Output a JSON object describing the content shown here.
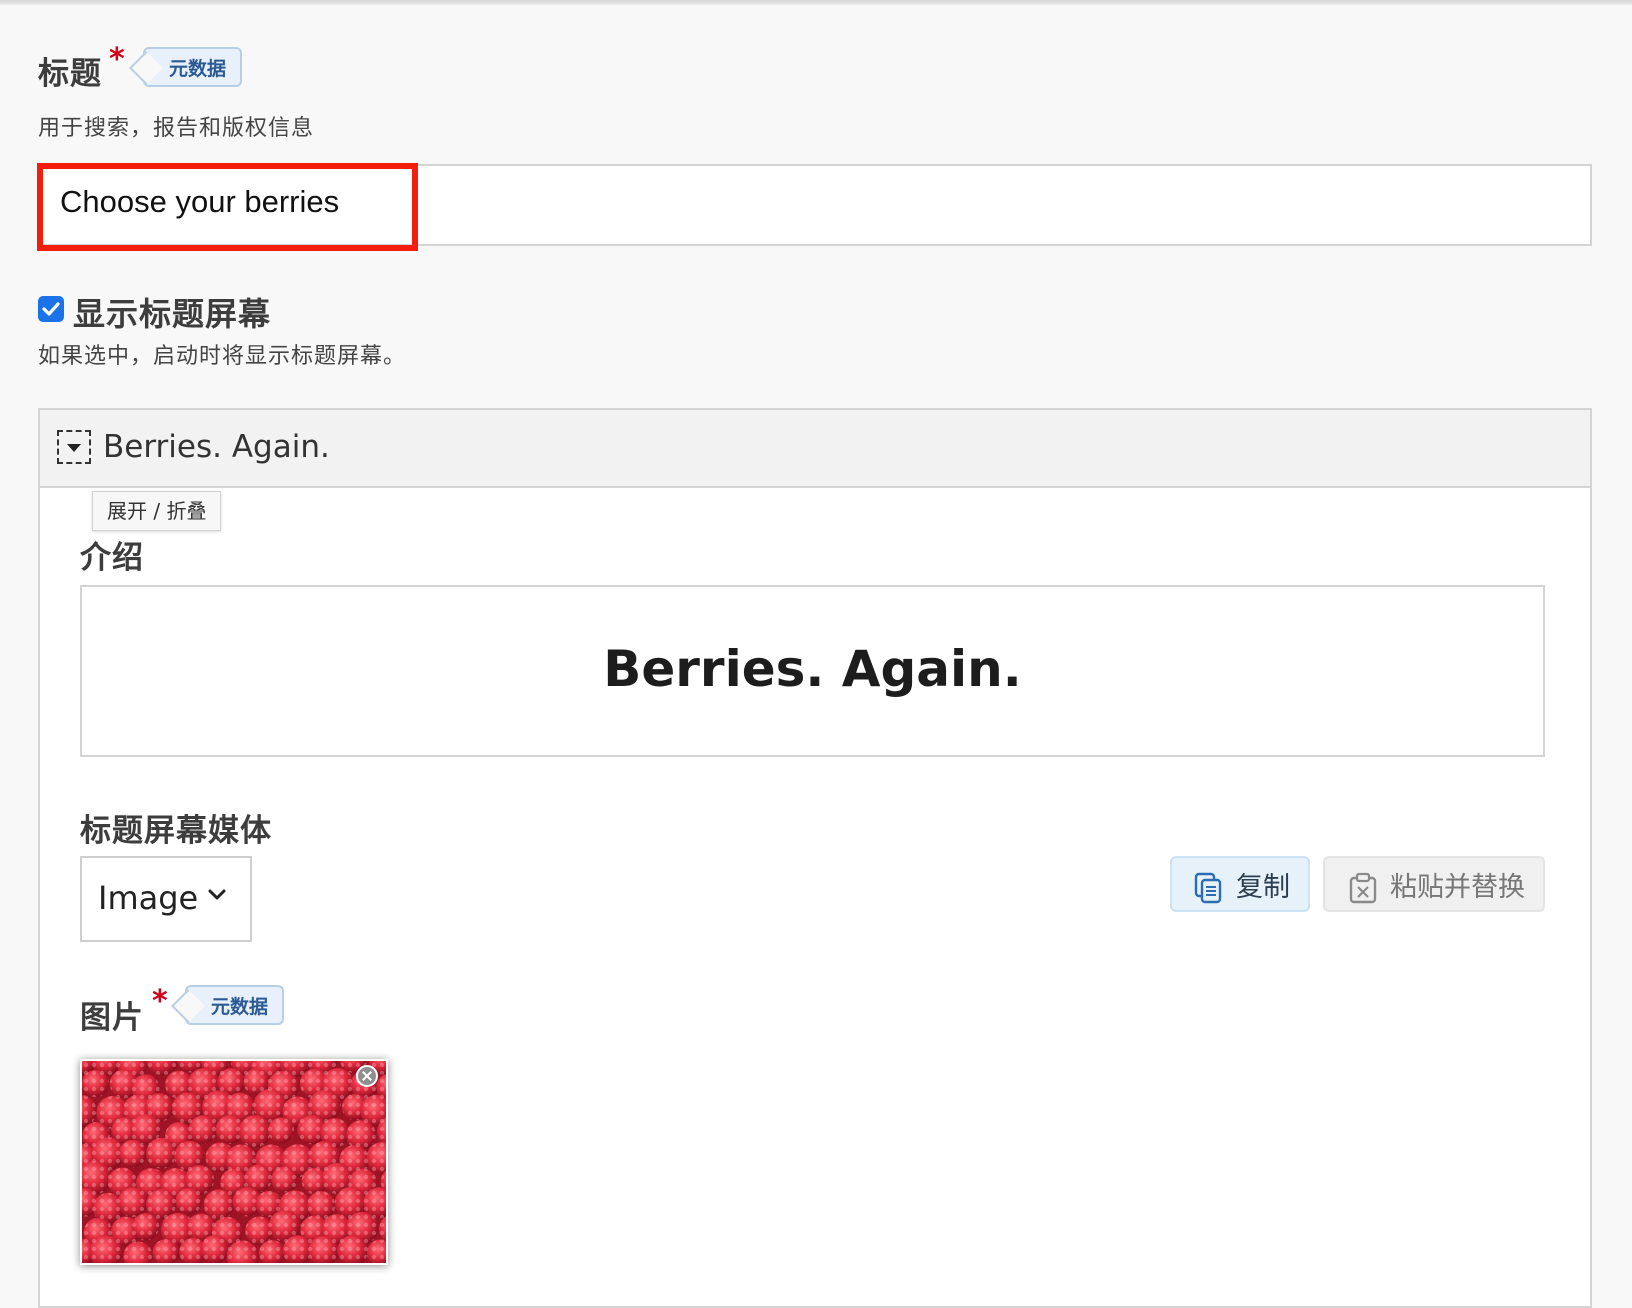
{
  "title_field": {
    "label": "标题",
    "required_mark": "*",
    "meta_tag": "元数据",
    "description": "用于搜索，报告和版权信息",
    "value": "Choose your berries"
  },
  "show_title_screen": {
    "checked": true,
    "label": "显示标题屏幕",
    "description": "如果选中，启动时将显示标题屏幕。"
  },
  "title_screen_panel": {
    "header_title": "Berries. Again.",
    "toggle_tooltip": "展开 / 折叠",
    "intro": {
      "label": "介绍",
      "content": "Berries. Again."
    },
    "media": {
      "label": "标题屏幕媒体",
      "selected": "Image",
      "copy_label": "复制",
      "paste_replace_label": "粘贴并替换"
    },
    "image_field": {
      "label": "图片",
      "required_mark": "*",
      "meta_tag": "元数据",
      "thumbnail_icon": "raspberries-photo"
    }
  },
  "colors": {
    "highlight": "#f21d0c",
    "checkbox": "#1a73e8",
    "required": "#d0021b",
    "meta_tag_bg": "#e8f1fb"
  }
}
